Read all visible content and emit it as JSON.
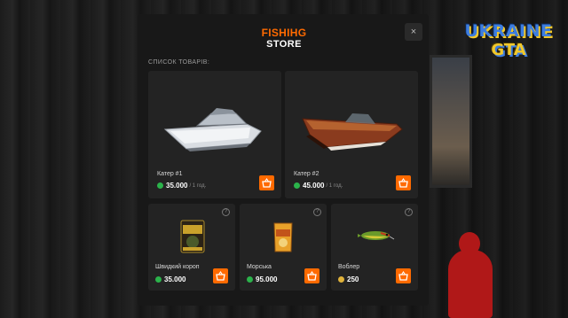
{
  "store": {
    "logo_top": "FISHIHG",
    "logo_bottom": "STORE",
    "close_label": "×",
    "section_title": "СПИСОК ТОВАРІВ:"
  },
  "game_logo": {
    "line1": "UKRAINE",
    "line2": "GTA"
  },
  "items": [
    {
      "name": "Катер #1",
      "price": "35.000",
      "period": "/ 1 год.",
      "currency": "money"
    },
    {
      "name": "Катер #2",
      "price": "45.000",
      "period": "/ 1 год.",
      "currency": "money"
    },
    {
      "name": "Швидкий короп",
      "price": "35.000",
      "period": "",
      "currency": "money",
      "pack_text": "BIG FISH"
    },
    {
      "name": "Морська",
      "price": "95.000",
      "period": "",
      "currency": "money"
    },
    {
      "name": "Воблер",
      "price": "250",
      "period": "",
      "currency": "gold"
    }
  ],
  "icons": {
    "buy": "basket-icon",
    "info": "question-icon",
    "money": "money-coin-icon",
    "gold": "gold-coin-icon"
  },
  "colors": {
    "accent": "#ff6a00",
    "money": "#2bb34b",
    "gold": "#e0b23a",
    "panel": "#181818",
    "card": "#232323"
  },
  "info_symbol": "?"
}
